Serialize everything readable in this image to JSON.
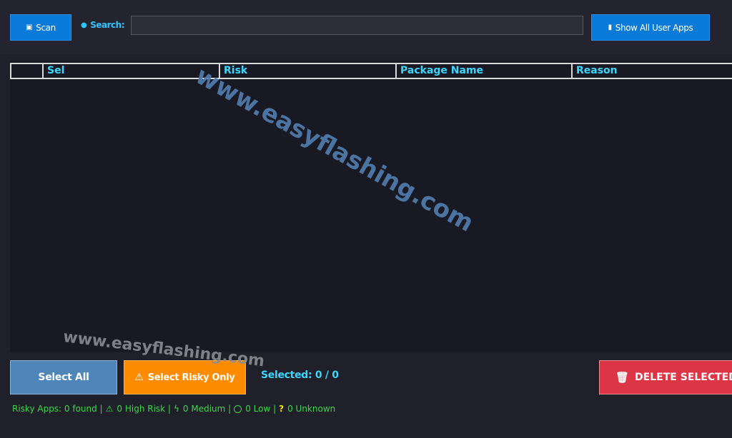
{
  "toolbar": {
    "scan_label": "Scan",
    "search_label": "Search:",
    "search_value": "",
    "show_all_label": "Show All User Apps"
  },
  "table": {
    "columns": [
      "",
      "Sel",
      "Risk",
      "Package Name",
      "Reason"
    ],
    "rows": []
  },
  "actions": {
    "select_all_label": "Select All",
    "select_risky_label": "Select Risky Only",
    "selected_text": "Selected: 0 / 0",
    "delete_label": "DELETE SELECTED"
  },
  "status": {
    "risky_apps": "Risky Apps: 0 found |",
    "high_risk": "0 High Risk |",
    "medium": "0 Medium |",
    "low": "0 Low |",
    "unknown": "0 Unknown"
  },
  "watermark": {
    "text": "www.easyflashing.com"
  },
  "colors": {
    "background": "#1f2029",
    "table_bg": "#181923",
    "accent_blue": "#0a7ad9",
    "header_text": "#3ad7ff",
    "select_all_bg": "#4f86b9",
    "risky_bg": "#ff8c00",
    "delete_bg": "#dc3545",
    "status_green": "#38d94a"
  },
  "icons": {
    "scan": "scan-icon",
    "search": "search-icon",
    "show_all": "phone-icon",
    "warning": "warning-icon",
    "delete": "trash-icon",
    "medium": "lightning-icon",
    "low": "circle-icon",
    "unknown": "question-icon"
  }
}
